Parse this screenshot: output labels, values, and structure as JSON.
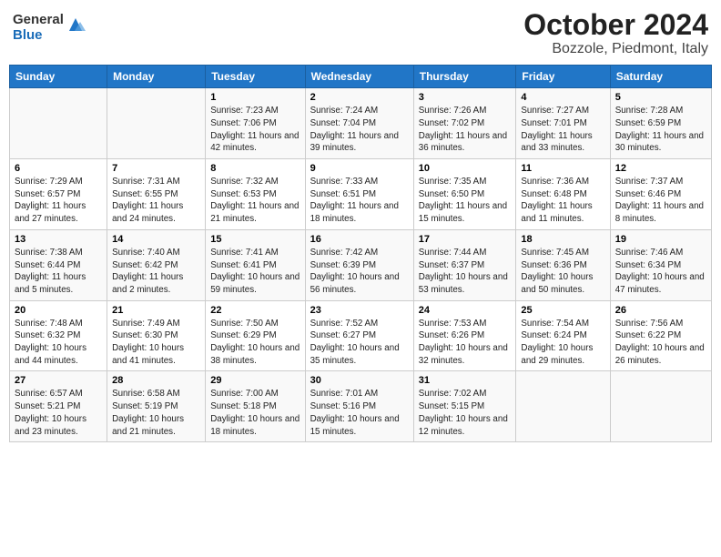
{
  "header": {
    "logo_general": "General",
    "logo_blue": "Blue",
    "title": "October 2024",
    "subtitle": "Bozzole, Piedmont, Italy"
  },
  "days_of_week": [
    "Sunday",
    "Monday",
    "Tuesday",
    "Wednesday",
    "Thursday",
    "Friday",
    "Saturday"
  ],
  "weeks": [
    [
      {
        "day": "",
        "sunrise": "",
        "sunset": "",
        "daylight": ""
      },
      {
        "day": "",
        "sunrise": "",
        "sunset": "",
        "daylight": ""
      },
      {
        "day": "1",
        "sunrise": "Sunrise: 7:23 AM",
        "sunset": "Sunset: 7:06 PM",
        "daylight": "Daylight: 11 hours and 42 minutes."
      },
      {
        "day": "2",
        "sunrise": "Sunrise: 7:24 AM",
        "sunset": "Sunset: 7:04 PM",
        "daylight": "Daylight: 11 hours and 39 minutes."
      },
      {
        "day": "3",
        "sunrise": "Sunrise: 7:26 AM",
        "sunset": "Sunset: 7:02 PM",
        "daylight": "Daylight: 11 hours and 36 minutes."
      },
      {
        "day": "4",
        "sunrise": "Sunrise: 7:27 AM",
        "sunset": "Sunset: 7:01 PM",
        "daylight": "Daylight: 11 hours and 33 minutes."
      },
      {
        "day": "5",
        "sunrise": "Sunrise: 7:28 AM",
        "sunset": "Sunset: 6:59 PM",
        "daylight": "Daylight: 11 hours and 30 minutes."
      }
    ],
    [
      {
        "day": "6",
        "sunrise": "Sunrise: 7:29 AM",
        "sunset": "Sunset: 6:57 PM",
        "daylight": "Daylight: 11 hours and 27 minutes."
      },
      {
        "day": "7",
        "sunrise": "Sunrise: 7:31 AM",
        "sunset": "Sunset: 6:55 PM",
        "daylight": "Daylight: 11 hours and 24 minutes."
      },
      {
        "day": "8",
        "sunrise": "Sunrise: 7:32 AM",
        "sunset": "Sunset: 6:53 PM",
        "daylight": "Daylight: 11 hours and 21 minutes."
      },
      {
        "day": "9",
        "sunrise": "Sunrise: 7:33 AM",
        "sunset": "Sunset: 6:51 PM",
        "daylight": "Daylight: 11 hours and 18 minutes."
      },
      {
        "day": "10",
        "sunrise": "Sunrise: 7:35 AM",
        "sunset": "Sunset: 6:50 PM",
        "daylight": "Daylight: 11 hours and 15 minutes."
      },
      {
        "day": "11",
        "sunrise": "Sunrise: 7:36 AM",
        "sunset": "Sunset: 6:48 PM",
        "daylight": "Daylight: 11 hours and 11 minutes."
      },
      {
        "day": "12",
        "sunrise": "Sunrise: 7:37 AM",
        "sunset": "Sunset: 6:46 PM",
        "daylight": "Daylight: 11 hours and 8 minutes."
      }
    ],
    [
      {
        "day": "13",
        "sunrise": "Sunrise: 7:38 AM",
        "sunset": "Sunset: 6:44 PM",
        "daylight": "Daylight: 11 hours and 5 minutes."
      },
      {
        "day": "14",
        "sunrise": "Sunrise: 7:40 AM",
        "sunset": "Sunset: 6:42 PM",
        "daylight": "Daylight: 11 hours and 2 minutes."
      },
      {
        "day": "15",
        "sunrise": "Sunrise: 7:41 AM",
        "sunset": "Sunset: 6:41 PM",
        "daylight": "Daylight: 10 hours and 59 minutes."
      },
      {
        "day": "16",
        "sunrise": "Sunrise: 7:42 AM",
        "sunset": "Sunset: 6:39 PM",
        "daylight": "Daylight: 10 hours and 56 minutes."
      },
      {
        "day": "17",
        "sunrise": "Sunrise: 7:44 AM",
        "sunset": "Sunset: 6:37 PM",
        "daylight": "Daylight: 10 hours and 53 minutes."
      },
      {
        "day": "18",
        "sunrise": "Sunrise: 7:45 AM",
        "sunset": "Sunset: 6:36 PM",
        "daylight": "Daylight: 10 hours and 50 minutes."
      },
      {
        "day": "19",
        "sunrise": "Sunrise: 7:46 AM",
        "sunset": "Sunset: 6:34 PM",
        "daylight": "Daylight: 10 hours and 47 minutes."
      }
    ],
    [
      {
        "day": "20",
        "sunrise": "Sunrise: 7:48 AM",
        "sunset": "Sunset: 6:32 PM",
        "daylight": "Daylight: 10 hours and 44 minutes."
      },
      {
        "day": "21",
        "sunrise": "Sunrise: 7:49 AM",
        "sunset": "Sunset: 6:30 PM",
        "daylight": "Daylight: 10 hours and 41 minutes."
      },
      {
        "day": "22",
        "sunrise": "Sunrise: 7:50 AM",
        "sunset": "Sunset: 6:29 PM",
        "daylight": "Daylight: 10 hours and 38 minutes."
      },
      {
        "day": "23",
        "sunrise": "Sunrise: 7:52 AM",
        "sunset": "Sunset: 6:27 PM",
        "daylight": "Daylight: 10 hours and 35 minutes."
      },
      {
        "day": "24",
        "sunrise": "Sunrise: 7:53 AM",
        "sunset": "Sunset: 6:26 PM",
        "daylight": "Daylight: 10 hours and 32 minutes."
      },
      {
        "day": "25",
        "sunrise": "Sunrise: 7:54 AM",
        "sunset": "Sunset: 6:24 PM",
        "daylight": "Daylight: 10 hours and 29 minutes."
      },
      {
        "day": "26",
        "sunrise": "Sunrise: 7:56 AM",
        "sunset": "Sunset: 6:22 PM",
        "daylight": "Daylight: 10 hours and 26 minutes."
      }
    ],
    [
      {
        "day": "27",
        "sunrise": "Sunrise: 6:57 AM",
        "sunset": "Sunset: 5:21 PM",
        "daylight": "Daylight: 10 hours and 23 minutes."
      },
      {
        "day": "28",
        "sunrise": "Sunrise: 6:58 AM",
        "sunset": "Sunset: 5:19 PM",
        "daylight": "Daylight: 10 hours and 21 minutes."
      },
      {
        "day": "29",
        "sunrise": "Sunrise: 7:00 AM",
        "sunset": "Sunset: 5:18 PM",
        "daylight": "Daylight: 10 hours and 18 minutes."
      },
      {
        "day": "30",
        "sunrise": "Sunrise: 7:01 AM",
        "sunset": "Sunset: 5:16 PM",
        "daylight": "Daylight: 10 hours and 15 minutes."
      },
      {
        "day": "31",
        "sunrise": "Sunrise: 7:02 AM",
        "sunset": "Sunset: 5:15 PM",
        "daylight": "Daylight: 10 hours and 12 minutes."
      },
      {
        "day": "",
        "sunrise": "",
        "sunset": "",
        "daylight": ""
      },
      {
        "day": "",
        "sunrise": "",
        "sunset": "",
        "daylight": ""
      }
    ]
  ]
}
